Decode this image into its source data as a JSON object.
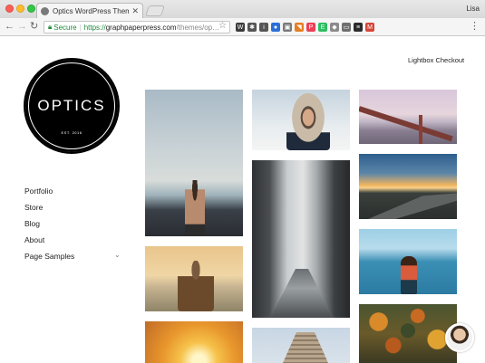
{
  "browser": {
    "tab_title": "Optics WordPress Theme | Gra",
    "tab_close": "✕",
    "user_name": "Lisa",
    "secure_label": "Secure",
    "url_scheme": "https://",
    "url_host": "graphpaperpress.com",
    "url_path": "/themes/op…",
    "icons": [
      "back-arrow-icon",
      "forward-arrow-icon",
      "reload-icon",
      "lock-icon",
      "star-icon",
      "menu-icon"
    ],
    "extensions": [
      {
        "name": "wordpress-ext-icon",
        "glyph": "W",
        "color": "#3b3b3b"
      },
      {
        "name": "gear-ext-icon",
        "glyph": "✱",
        "color": "#555555"
      },
      {
        "name": "info-ext-icon",
        "glyph": "i",
        "color": "#555555"
      },
      {
        "name": "onepassword-ext-icon",
        "glyph": "●",
        "color": "#2b6fd6"
      },
      {
        "name": "square-ext-icon",
        "glyph": "▣",
        "color": "#7a7a7a"
      },
      {
        "name": "rss-ext-icon",
        "glyph": "◥",
        "color": "#e67e22"
      },
      {
        "name": "pocket-ext-icon",
        "glyph": "P",
        "color": "#ef3f56"
      },
      {
        "name": "evernote-ext-icon",
        "glyph": "E",
        "color": "#2dbe60"
      },
      {
        "name": "shield-ext-icon",
        "glyph": "◆",
        "color": "#8a8a8a"
      },
      {
        "name": "cast-ext-icon",
        "glyph": "▭",
        "color": "#6f6f6f"
      },
      {
        "name": "buffer-ext-icon",
        "glyph": "≡",
        "color": "#2b2b2b"
      },
      {
        "name": "gmail-ext-icon",
        "glyph": "M",
        "color": "#d44638"
      }
    ]
  },
  "site": {
    "logo_text": "OPTICS",
    "logo_est": "EST. 2016",
    "lightbox_label": "Lightbox Checkout",
    "nav": [
      "Portfolio",
      "Store",
      "Blog",
      "About",
      "Page Samples"
    ],
    "chevron": "⌄"
  },
  "photos": [
    {
      "name": "photo-man-by-sea",
      "desc": "shirtless man by sea"
    },
    {
      "name": "photo-fur-hood",
      "desc": "woman in fur hood"
    },
    {
      "name": "photo-golden-gate",
      "desc": "golden gate bridge"
    },
    {
      "name": "photo-woman-scarf",
      "desc": "woman in scarf at beach"
    },
    {
      "name": "photo-misty-canyon",
      "desc": "misty canyon river"
    },
    {
      "name": "photo-mountain-road",
      "desc": "mountain road sunset"
    },
    {
      "name": "photo-canoe-lake",
      "desc": "woman in canoe on lake"
    },
    {
      "name": "photo-sunset",
      "desc": "sunset over field"
    },
    {
      "name": "photo-flatiron",
      "desc": "flatiron building"
    },
    {
      "name": "photo-autumn-forest",
      "desc": "autumn forest from above"
    }
  ],
  "colors": {
    "link_text": "#222222",
    "secure_green": "#1e8a3a"
  }
}
